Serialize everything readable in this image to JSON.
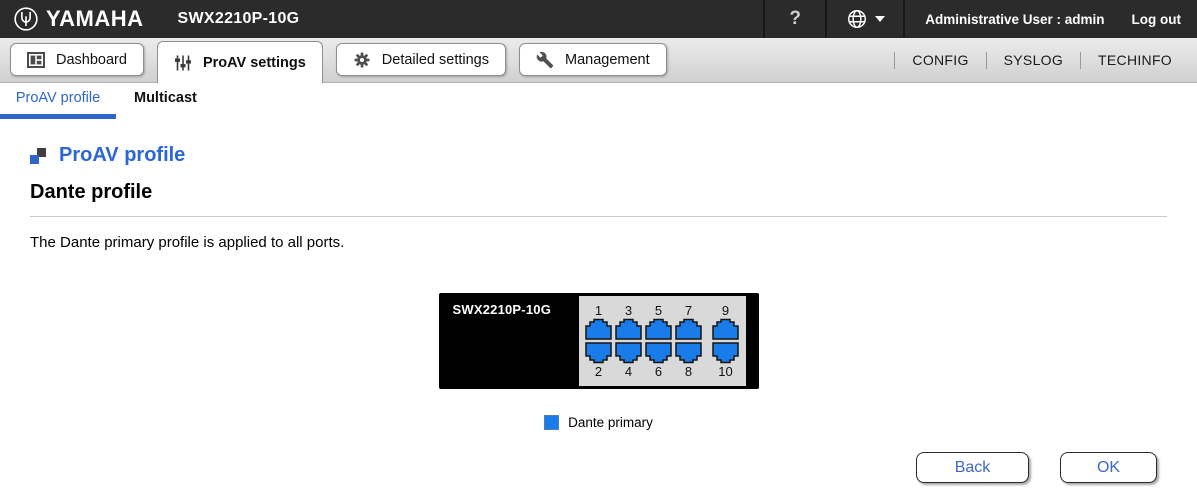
{
  "topbar": {
    "brand": "YAMAHA",
    "device_title": "SWX2210P-10G",
    "help_label": "?",
    "user_label": "Administrative User : admin",
    "logout_label": "Log out"
  },
  "tabs": [
    {
      "label": "Dashboard",
      "icon": "dashboard-icon",
      "active": false
    },
    {
      "label": "ProAV settings",
      "icon": "faders-icon",
      "active": true
    },
    {
      "label": "Detailed settings",
      "icon": "gear-icon",
      "active": false
    },
    {
      "label": "Management",
      "icon": "wrench-icon",
      "active": false
    }
  ],
  "quick_links": [
    {
      "label": "CONFIG"
    },
    {
      "label": "SYSLOG"
    },
    {
      "label": "TECHINFO"
    }
  ],
  "subtabs": [
    {
      "label": "ProAV profile",
      "active": true
    },
    {
      "label": "Multicast",
      "active": false
    }
  ],
  "page": {
    "section_title": "ProAV profile",
    "heading": "Dante profile",
    "description": "The Dante primary profile is applied to all ports."
  },
  "device": {
    "model_label": "SWX2210P-10G",
    "port_columns": [
      {
        "top": "1",
        "bottom": "2"
      },
      {
        "top": "3",
        "bottom": "4"
      },
      {
        "top": "5",
        "bottom": "6"
      },
      {
        "top": "7",
        "bottom": "8"
      },
      {
        "top": "9",
        "bottom": "10"
      }
    ],
    "ports_profile": "Dante primary"
  },
  "legend": {
    "label": "Dante primary",
    "swatch_color": "#1a7ce8"
  },
  "buttons": {
    "back": "Back",
    "ok": "OK"
  },
  "colors": {
    "topbar_bg": "#2b2b2b",
    "accent_blue": "#2f66cc",
    "port_blue": "#1a7ce8",
    "switch_body": "#000000",
    "port_panel_bg": "#d9d9d9"
  }
}
